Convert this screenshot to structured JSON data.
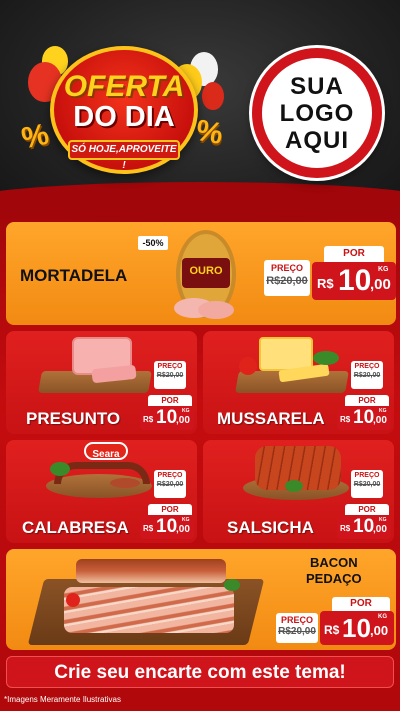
{
  "header": {
    "badge_title": "OFERTA",
    "badge_subtitle": "DO DIA",
    "badge_tagline": "SÓ HOJE,APROVEITE !",
    "percent_symbol": "%",
    "logo_lines": [
      "SUA",
      "LOGO",
      "AQUI"
    ]
  },
  "featured": {
    "name": "MORTADELA",
    "discount": "-50%",
    "brand_label": "OURO",
    "old_label": "PREÇO",
    "old_price": "R$20,00",
    "new_label": "POR",
    "currency": "R$",
    "price_int": "10",
    "price_cents": ",00",
    "unit": "KG"
  },
  "products": [
    {
      "name": "PRESUNTO",
      "old_label": "PREÇO",
      "old_price": "R$20,00",
      "new_label": "POR",
      "currency": "R$",
      "price_int": "10",
      "price_cents": ",00",
      "unit": "KG"
    },
    {
      "name": "MUSSARELA",
      "old_label": "PREÇO",
      "old_price": "R$20,00",
      "new_label": "POR",
      "currency": "R$",
      "price_int": "10",
      "price_cents": ",00",
      "unit": "KG"
    },
    {
      "name": "CALABRESA",
      "brand_label": "Seara",
      "old_label": "PREÇO",
      "old_price": "R$20,00",
      "new_label": "POR",
      "currency": "R$",
      "price_int": "10",
      "price_cents": ",00",
      "unit": "KG"
    },
    {
      "name": "SALSICHA",
      "old_label": "PREÇO",
      "old_price": "R$20,00",
      "new_label": "POR",
      "currency": "R$",
      "price_int": "10",
      "price_cents": ",00",
      "unit": "KG"
    }
  ],
  "bacon": {
    "name_line1": "BACON",
    "name_line2": "PEDAÇO",
    "old_label": "PREÇO",
    "old_price": "R$20,00",
    "new_label": "POR",
    "currency": "R$",
    "price_int": "10",
    "price_cents": ",00",
    "unit": "KG"
  },
  "cta": "Crie seu encarte com este tema!",
  "footnote": "*Imagens Meramente Ilustrativas",
  "colors": {
    "red": "#d0141c",
    "orange": "#f7961e",
    "gold": "#ffc21a"
  }
}
